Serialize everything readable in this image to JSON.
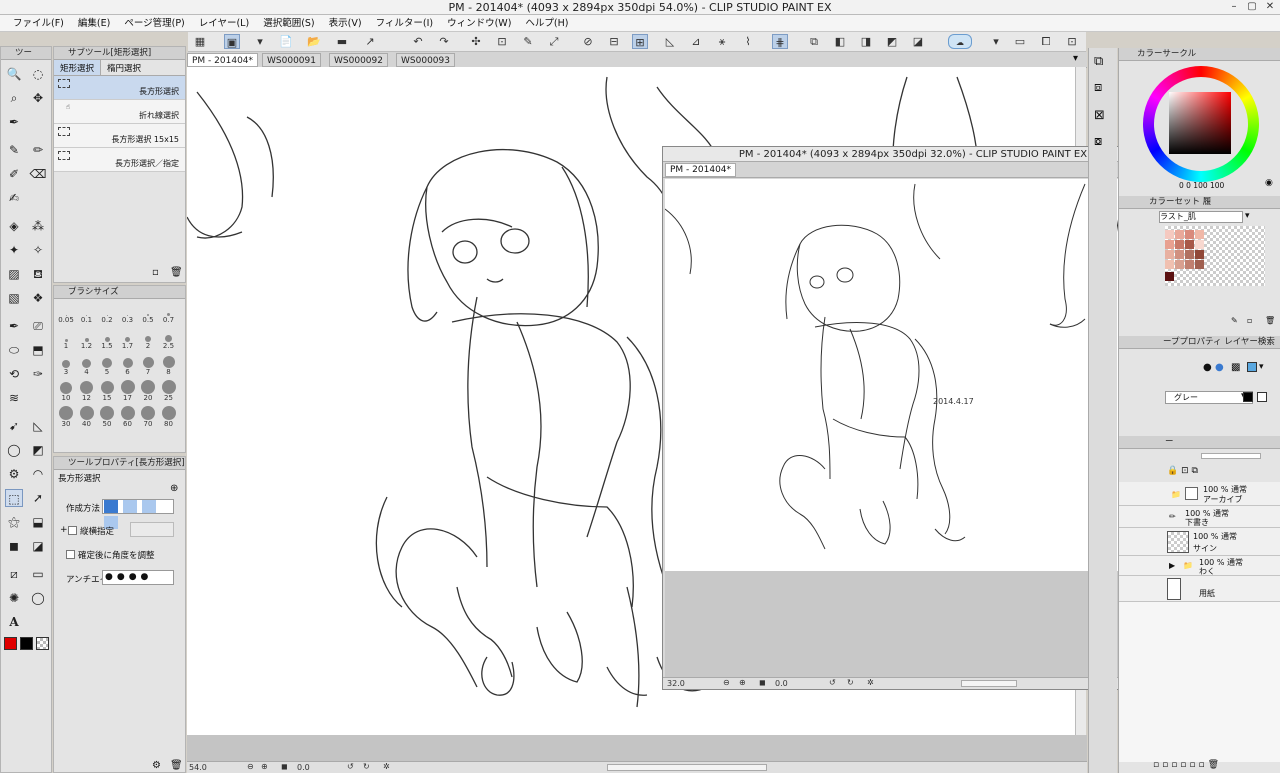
{
  "window": {
    "title": "PM - 201404* (4093 x 2894px 350dpi 54.0%)  - CLIP STUDIO PAINT EX"
  },
  "menu": [
    "ファイル(F)",
    "編集(E)",
    "ページ管理(P)",
    "レイヤー(L)",
    "選択範囲(S)",
    "表示(V)",
    "フィルター(I)",
    "ウィンドウ(W)",
    "ヘルプ(H)"
  ],
  "tool_panel": {
    "tab": "ツー"
  },
  "sub_tool": {
    "tab": "サブツール[矩形選択]",
    "groups": [
      "矩形選択",
      "楕円選択"
    ],
    "items": [
      "長方形選択",
      "折れ線選択",
      "長方形選択 15x15",
      "長方形選択／指定"
    ]
  },
  "brush_size": {
    "tab": "ブラシサイズ",
    "sizes": [
      "0.05",
      "0.1",
      "0.2",
      "0.3",
      "0.5",
      "0.7",
      "1",
      "1.2",
      "1.5",
      "1.7",
      "2",
      "2.5",
      "3",
      "4",
      "5",
      "6",
      "7",
      "8",
      "10",
      "12",
      "15",
      "17",
      "20",
      "25",
      "30",
      "40",
      "50",
      "60",
      "70",
      "80"
    ]
  },
  "tool_property": {
    "tab": "ツールプロパティ[長方形選択]",
    "name": "長方形選択",
    "create_method_label": "作成方法",
    "aspect_label": "縦横指定",
    "angle_label": "確定後に角度を調整",
    "antialias_label": "アンチエイ"
  },
  "document_tabs": [
    "PM - 201404*",
    "WS000091",
    "WS000092",
    "WS000093"
  ],
  "main_status": {
    "zoom": "54.0",
    "angle": "0.0"
  },
  "subview": {
    "title": "PM - 201404* (4093 x 2894px 350dpi 32.0%)  - CLIP STUDIO PAINT EX",
    "tab": "PM - 201404*",
    "zoom": "32.0",
    "angle": "0.0",
    "date_annotation": "2014.4.17"
  },
  "color_circle": {
    "tab": "カラーサークル",
    "hsv_readout": "0  0 100  100"
  },
  "color_set": {
    "tab": "カラーセット",
    "tab2": "履",
    "set_name": "ラスト_肌"
  },
  "layer_property": {
    "tab": "ーププロパティ",
    "tab2": "レイヤー検索",
    "expression": "グレー"
  },
  "layers": {
    "tab": "ー",
    "items": [
      {
        "mode": "100 %  通常",
        "name": "アーカイブ"
      },
      {
        "mode": "100 %  通常",
        "name": "下書き"
      },
      {
        "mode": "100 %  通常",
        "name": "サイン"
      },
      {
        "mode": "100 %  通常",
        "name": "わく"
      },
      {
        "mode": "",
        "name": "用紙"
      }
    ]
  },
  "colors": {
    "main": "#e00000",
    "sub": "#000000",
    "accent": "#7d9cc4"
  }
}
